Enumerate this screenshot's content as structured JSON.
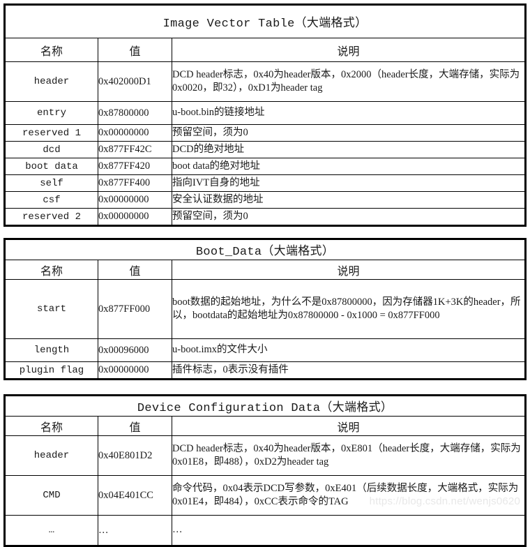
{
  "document": {
    "watermark": "https://blog.csdn.net/wenjs0620"
  },
  "tables": [
    {
      "title": "Image Vector Table（大端格式）",
      "headers": {
        "name": "名称",
        "value": "值",
        "description": "说明"
      },
      "rows": [
        {
          "name": "header",
          "value": "0x402000D1",
          "description": "DCD header标志，0x40为header版本，0x2000（header长度，大端存储，实际为0x0020，即32），0xD1为header tag"
        },
        {
          "name": "entry",
          "value": "0x87800000",
          "description": "u-boot.bin的链接地址"
        },
        {
          "name": "reserved 1",
          "value": "0x00000000",
          "description": "预留空间，须为0"
        },
        {
          "name": "dcd",
          "value": "0x877FF42C",
          "description": "DCD的绝对地址"
        },
        {
          "name": "boot data",
          "value": "0x877FF420",
          "description": "boot data的绝对地址"
        },
        {
          "name": "self",
          "value": "0x877FF400",
          "description": "指向IVT自身的地址"
        },
        {
          "name": "csf",
          "value": "0x00000000",
          "description": "安全认证数据的地址"
        },
        {
          "name": "reserved 2",
          "value": "0x00000000",
          "description": "预留空间，须为0"
        }
      ]
    },
    {
      "title": "Boot_Data（大端格式）",
      "headers": {
        "name": "名称",
        "value": "值",
        "description": "说明"
      },
      "rows": [
        {
          "name": "start",
          "value": "0x877FF000",
          "description": "boot数据的起始地址，为什么不是0x87800000，因为存储器1K+3K的header，所以，bootdata的起始地址为0x87800000 - 0x1000 = 0x877FF000"
        },
        {
          "name": "length",
          "value": "0x00096000",
          "description": "u-boot.imx的文件大小"
        },
        {
          "name": "plugin flag",
          "value": "0x00000000",
          "description": "插件标志，0表示没有插件"
        }
      ]
    },
    {
      "title": "Device Configuration Data（大端格式）",
      "headers": {
        "name": "名称",
        "value": "值",
        "description": "说明"
      },
      "rows": [
        {
          "name": "header",
          "value": "0x40E801D2",
          "description": "DCD header标志，0x40为header版本，0xE801（header长度，大端存储，实际为0x01E8，即488），0xD2为header tag"
        },
        {
          "name": "CMD",
          "value": "0x04E401CC",
          "description": "命令代码，0x04表示DCD写参数，0xE401（后续数据长度，大端格式，实际为0x01E4，即484），0xCC表示命令的TAG"
        },
        {
          "name": "…",
          "value": "…",
          "description": "…"
        }
      ]
    }
  ]
}
